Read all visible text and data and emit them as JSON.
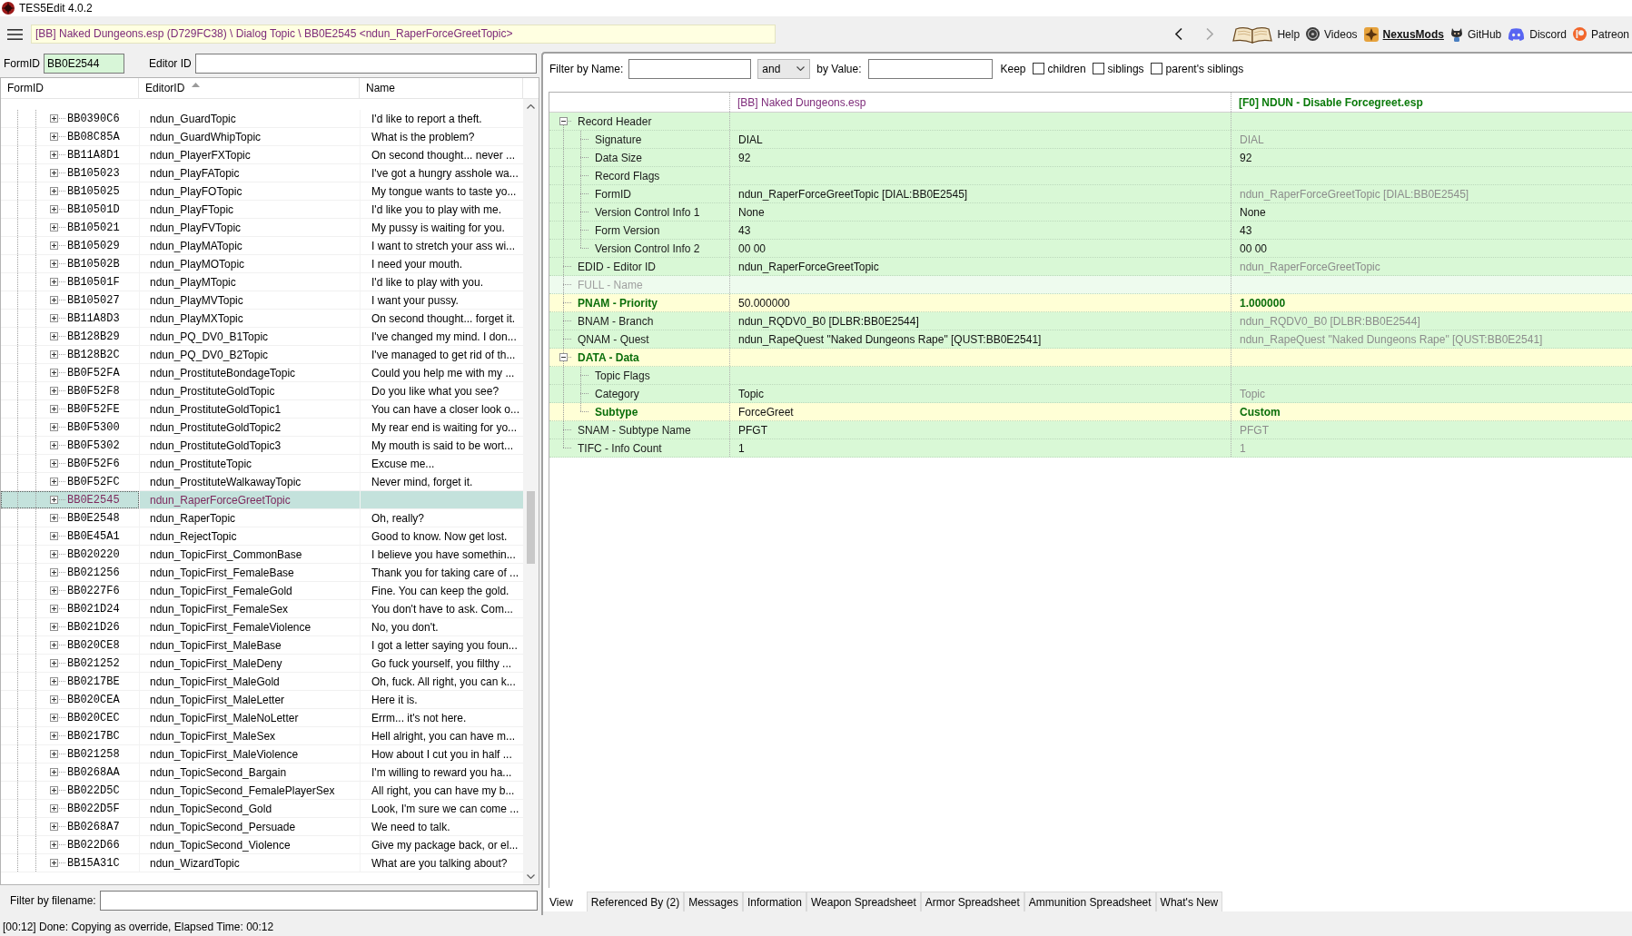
{
  "window": {
    "title": "TES5Edit 4.0.2"
  },
  "toolbar": {
    "breadcrumb": "[BB] Naked Dungeons.esp (D729FC38) \\ Dialog Topic \\ BB0E2545 <ndun_RaperForceGreetTopic>",
    "navigation": {
      "back": {
        "disabled": false
      },
      "forward": {
        "disabled": true
      }
    },
    "links": [
      {
        "label": "Help",
        "kind": "book",
        "highlighted": false
      },
      {
        "label": "Videos",
        "kind": "disc",
        "highlighted": false
      },
      {
        "label": "NexusMods",
        "kind": "star",
        "highlighted": true
      },
      {
        "label": "GitHub",
        "kind": "cat",
        "highlighted": false
      },
      {
        "label": "Discord",
        "kind": "controller",
        "highlighted": false
      },
      {
        "label": "Patreon",
        "kind": "ring",
        "highlighted": false
      }
    ]
  },
  "left_panel": {
    "form_id": {
      "label": "FormID",
      "value": "BB0E2544"
    },
    "editor_id": {
      "label": "Editor ID"
    },
    "columns": [
      {
        "label": "FormID",
        "sorted": false
      },
      {
        "label": "EditorID",
        "sorted": true
      },
      {
        "label": "Name",
        "sorted": false
      }
    ],
    "rows": [
      {
        "form_id": "BB0390C6",
        "editor_id": "ndun_GuardTopic",
        "name": "I'd like to report a theft.",
        "selected": false,
        "expanded": false,
        "overridden": false
      },
      {
        "form_id": "BB08C85A",
        "editor_id": "ndun_GuardWhipTopic",
        "name": "What is the problem?",
        "selected": false,
        "expanded": false,
        "overridden": false
      },
      {
        "form_id": "BB11A8D1",
        "editor_id": "ndun_PlayerFXTopic",
        "name": "On second thought... never ...",
        "selected": false,
        "expanded": false,
        "overridden": false
      },
      {
        "form_id": "BB105023",
        "editor_id": "ndun_PlayFATopic",
        "name": "I've got a hungry asshole wa...",
        "selected": false,
        "expanded": false,
        "overridden": false
      },
      {
        "form_id": "BB105025",
        "editor_id": "ndun_PlayFOTopic",
        "name": "My tongue wants to taste yo...",
        "selected": false,
        "expanded": false,
        "overridden": false
      },
      {
        "form_id": "BB10501D",
        "editor_id": "ndun_PlayFTopic",
        "name": "I'd like you to play with me.",
        "selected": false,
        "expanded": false,
        "overridden": false
      },
      {
        "form_id": "BB105021",
        "editor_id": "ndun_PlayFVTopic",
        "name": "My pussy is waiting for you.",
        "selected": false,
        "expanded": false,
        "overridden": false
      },
      {
        "form_id": "BB105029",
        "editor_id": "ndun_PlayMATopic",
        "name": "I want to stretch your ass wi...",
        "selected": false,
        "expanded": false,
        "overridden": false
      },
      {
        "form_id": "BB10502B",
        "editor_id": "ndun_PlayMOTopic",
        "name": "I need your mouth.",
        "selected": false,
        "expanded": false,
        "overridden": false
      },
      {
        "form_id": "BB10501F",
        "editor_id": "ndun_PlayMTopic",
        "name": "I'd like to play with you.",
        "selected": false,
        "expanded": false,
        "overridden": false
      },
      {
        "form_id": "BB105027",
        "editor_id": "ndun_PlayMVTopic",
        "name": "I want your pussy.",
        "selected": false,
        "expanded": false,
        "overridden": false
      },
      {
        "form_id": "BB11A8D3",
        "editor_id": "ndun_PlayMXTopic",
        "name": "On second thought... forget it.",
        "selected": false,
        "expanded": false,
        "overridden": false
      },
      {
        "form_id": "BB128B29",
        "editor_id": "ndun_PQ_DV0_B1Topic",
        "name": "I've changed my mind. I don...",
        "selected": false,
        "expanded": false,
        "overridden": false
      },
      {
        "form_id": "BB128B2C",
        "editor_id": "ndun_PQ_DV0_B2Topic",
        "name": "I've managed to get rid of th...",
        "selected": false,
        "expanded": false,
        "overridden": false
      },
      {
        "form_id": "BB0F52FA",
        "editor_id": "ndun_ProstituteBondageTopic",
        "name": "Could you help me with my ...",
        "selected": false,
        "expanded": false,
        "overridden": false
      },
      {
        "form_id": "BB0F52F8",
        "editor_id": "ndun_ProstituteGoldTopic",
        "name": "Do you like what you see?",
        "selected": false,
        "expanded": false,
        "overridden": false
      },
      {
        "form_id": "BB0F52FE",
        "editor_id": "ndun_ProstituteGoldTopic1",
        "name": "You can have a closer look o...",
        "selected": false,
        "expanded": false,
        "overridden": false
      },
      {
        "form_id": "BB0F5300",
        "editor_id": "ndun_ProstituteGoldTopic2",
        "name": "My rear end is waiting for yo...",
        "selected": false,
        "expanded": false,
        "overridden": false
      },
      {
        "form_id": "BB0F5302",
        "editor_id": "ndun_ProstituteGoldTopic3",
        "name": "My mouth is said to be wort...",
        "selected": false,
        "expanded": false,
        "overridden": false
      },
      {
        "form_id": "BB0F52F6",
        "editor_id": "ndun_ProstituteTopic",
        "name": "Excuse me...",
        "selected": false,
        "expanded": false,
        "overridden": false
      },
      {
        "form_id": "BB0F52FC",
        "editor_id": "ndun_ProstituteWalkawayTopic",
        "name": "Never mind, forget it.",
        "selected": false,
        "expanded": false,
        "overridden": false
      },
      {
        "form_id": "BB0E2545",
        "editor_id": "ndun_RaperForceGreetTopic",
        "selected": true,
        "expanded": false,
        "overridden": true
      },
      {
        "form_id": "BB0E2548",
        "editor_id": "ndun_RaperTopic",
        "name": "Oh, really?",
        "selected": false,
        "expanded": false,
        "overridden": false
      },
      {
        "form_id": "BB0E45A1",
        "editor_id": "ndun_RejectTopic",
        "name": "Good to know. Now get lost.",
        "selected": false,
        "expanded": false,
        "overridden": false
      },
      {
        "form_id": "BB020220",
        "editor_id": "ndun_TopicFirst_CommonBase",
        "name": "I believe you have somethin...",
        "selected": false,
        "expanded": false,
        "overridden": false
      },
      {
        "form_id": "BB021256",
        "editor_id": "ndun_TopicFirst_FemaleBase",
        "name": "Thank you for taking care of ...",
        "selected": false,
        "expanded": false,
        "overridden": false
      },
      {
        "form_id": "BB0227F6",
        "editor_id": "ndun_TopicFirst_FemaleGold",
        "name": "Fine. You can keep the gold.",
        "selected": false,
        "expanded": false,
        "overridden": false
      },
      {
        "form_id": "BB021D24",
        "editor_id": "ndun_TopicFirst_FemaleSex",
        "name": "You don't have to ask. Com...",
        "selected": false,
        "expanded": false,
        "overridden": false
      },
      {
        "form_id": "BB021D26",
        "editor_id": "ndun_TopicFirst_FemaleViolence",
        "name": "No, you don't.",
        "selected": false,
        "expanded": false,
        "overridden": false
      },
      {
        "form_id": "BB020CE8",
        "editor_id": "ndun_TopicFirst_MaleBase",
        "name": "I got a letter saying you foun...",
        "selected": false,
        "expanded": false,
        "overridden": false
      },
      {
        "form_id": "BB021252",
        "editor_id": "ndun_TopicFirst_MaleDeny",
        "name": "Go fuck yourself, you filthy ...",
        "selected": false,
        "expanded": false,
        "overridden": false
      },
      {
        "form_id": "BB0217BE",
        "editor_id": "ndun_TopicFirst_MaleGold",
        "name": "Oh, fuck. All right, you can k...",
        "selected": false,
        "expanded": false,
        "overridden": false
      },
      {
        "form_id": "BB020CEA",
        "editor_id": "ndun_TopicFirst_MaleLetter",
        "name": "Here it is.",
        "selected": false,
        "expanded": false,
        "overridden": false
      },
      {
        "form_id": "BB020CEC",
        "editor_id": "ndun_TopicFirst_MaleNoLetter",
        "name": "Errm... it's not here.",
        "selected": false,
        "expanded": false,
        "overridden": false
      },
      {
        "form_id": "BB0217BC",
        "editor_id": "ndun_TopicFirst_MaleSex",
        "name": "Hell alright, you can have m...",
        "selected": false,
        "expanded": false,
        "overridden": false
      },
      {
        "form_id": "BB021258",
        "editor_id": "ndun_TopicFirst_MaleViolence",
        "name": "How about I cut you in half ...",
        "selected": false,
        "expanded": false,
        "overridden": false
      },
      {
        "form_id": "BB0268AA",
        "editor_id": "ndun_TopicSecond_Bargain",
        "name": "I'm willing to reward you ha...",
        "selected": false,
        "expanded": false,
        "overridden": false
      },
      {
        "form_id": "BB022D5C",
        "editor_id": "ndun_TopicSecond_FemalePlayerSex",
        "name": "All right, you can have my b...",
        "selected": false,
        "expanded": false,
        "overridden": false
      },
      {
        "form_id": "BB022D5F",
        "editor_id": "ndun_TopicSecond_Gold",
        "name": "Look, I'm sure we can come ...",
        "selected": false,
        "expanded": false,
        "overridden": false
      },
      {
        "form_id": "BB0268A7",
        "editor_id": "ndun_TopicSecond_Persuade",
        "name": "We need to talk.",
        "selected": false,
        "expanded": false,
        "overridden": false
      },
      {
        "form_id": "BB022D66",
        "editor_id": "ndun_TopicSecond_Violence",
        "name": "Give my package back, or el...",
        "selected": false,
        "expanded": false,
        "overridden": false
      },
      {
        "form_id": "BB15A31C",
        "editor_id": "ndun_WizardTopic",
        "name": "What are you talking about?",
        "selected": false,
        "expanded": false,
        "overridden": false
      }
    ],
    "filter": {
      "label": "Filter by filename:"
    }
  },
  "right_panel": {
    "filter": {
      "name_label": "Filter by Name:",
      "operator": "and",
      "value_label": "by Value:",
      "keep_label": "Keep",
      "options": [
        {
          "label": "children",
          "checked": false
        },
        {
          "label": "siblings",
          "checked": false
        },
        {
          "label": "parent's siblings",
          "checked": false
        }
      ]
    },
    "record": {
      "files": [
        {
          "name": "[BB] Naked Dungeons.esp",
          "kind": "override"
        },
        {
          "name": "[F0] NDUN - Disable Forcegreet.esp",
          "kind": "winner"
        }
      ],
      "rows": [
        {
          "label": "Record Header",
          "kind": "normal",
          "expanded": true,
          "children": [
            {
              "label": "Signature",
              "kind": "normal",
              "values": [
                {
                  "text": "DIAL",
                  "kind": "normal"
                },
                {
                  "text": "DIAL",
                  "kind": "identical"
                }
              ]
            },
            {
              "label": "Data Size",
              "kind": "normal",
              "values": [
                {
                  "text": "92",
                  "kind": "normal"
                },
                {
                  "text": "92",
                  "kind": "normal"
                }
              ]
            },
            {
              "label": "Record Flags",
              "kind": "normal"
            },
            {
              "label": "FormID",
              "kind": "normal",
              "values": [
                {
                  "text": "ndun_RaperForceGreetTopic [DIAL:BB0E2545]",
                  "kind": "normal"
                },
                {
                  "text": "ndun_RaperForceGreetTopic [DIAL:BB0E2545]",
                  "kind": "identical"
                }
              ]
            },
            {
              "label": "Version Control Info 1",
              "kind": "normal",
              "values": [
                {
                  "text": "None",
                  "kind": "normal"
                },
                {
                  "text": "None",
                  "kind": "normal"
                }
              ]
            },
            {
              "label": "Form Version",
              "kind": "normal",
              "values": [
                {
                  "text": "43",
                  "kind": "normal"
                },
                {
                  "text": "43",
                  "kind": "normal"
                }
              ]
            },
            {
              "label": "Version Control Info 2",
              "kind": "normal",
              "values": [
                {
                  "text": "00 00",
                  "kind": "normal"
                },
                {
                  "text": "00 00",
                  "kind": "normal"
                }
              ]
            }
          ]
        },
        {
          "label": "EDID - Editor ID",
          "kind": "normal",
          "values": [
            {
              "text": "ndun_RaperForceGreetTopic",
              "kind": "normal"
            },
            {
              "text": "ndun_RaperForceGreetTopic",
              "kind": "identical"
            }
          ]
        },
        {
          "label": "FULL - Name",
          "kind": "empty"
        },
        {
          "label": "PNAM - Priority",
          "kind": "winner",
          "values": [
            {
              "text": "50.000000",
              "kind": "normal"
            },
            {
              "text": "1.000000",
              "kind": "winner"
            }
          ]
        },
        {
          "label": "BNAM - Branch",
          "kind": "normal",
          "values": [
            {
              "text": "ndun_RQDV0_B0 [DLBR:BB0E2544]",
              "kind": "normal"
            },
            {
              "text": "ndun_RQDV0_B0 [DLBR:BB0E2544]",
              "kind": "identical"
            }
          ]
        },
        {
          "label": "QNAM - Quest",
          "kind": "normal",
          "values": [
            {
              "text": "ndun_RapeQuest \"Naked Dungeons Rape\" [QUST:BB0E2541]",
              "kind": "normal"
            },
            {
              "text": "ndun_RapeQuest \"Naked Dungeons Rape\" [QUST:BB0E2541]",
              "kind": "identical"
            }
          ]
        },
        {
          "label": "DATA - Data",
          "kind": "winner",
          "expanded": true,
          "children": [
            {
              "label": "Topic Flags",
              "kind": "normal"
            },
            {
              "label": "Category",
              "kind": "normal",
              "values": [
                {
                  "text": "Topic",
                  "kind": "normal"
                },
                {
                  "text": "Topic",
                  "kind": "identical"
                }
              ]
            },
            {
              "label": "Subtype",
              "kind": "winner",
              "values": [
                {
                  "text": "ForceGreet",
                  "kind": "normal"
                },
                {
                  "text": "Custom",
                  "kind": "winner"
                }
              ]
            }
          ]
        },
        {
          "label": "SNAM - Subtype Name",
          "kind": "normal",
          "values": [
            {
              "text": "PFGT",
              "kind": "normal"
            },
            {
              "text": "PFGT",
              "kind": "identical"
            }
          ]
        },
        {
          "label": "TIFC - Info Count",
          "kind": "normal",
          "values": [
            {
              "text": "1",
              "kind": "normal"
            },
            {
              "text": "1",
              "kind": "identical"
            }
          ]
        }
      ]
    },
    "tabs": [
      {
        "label": "View",
        "selected": true
      },
      {
        "label": "Referenced By (2)",
        "selected": false
      },
      {
        "label": "Messages",
        "selected": false
      },
      {
        "label": "Information",
        "selected": false
      },
      {
        "label": "Weapon Spreadsheet",
        "selected": false
      },
      {
        "label": "Armor Spreadsheet",
        "selected": false
      },
      {
        "label": "Ammunition Spreadsheet",
        "selected": false
      },
      {
        "label": "What's New",
        "selected": false
      }
    ]
  },
  "status_bar": {
    "text": "[00:12] Done: Copying as override, Elapsed Time: 00:12"
  }
}
